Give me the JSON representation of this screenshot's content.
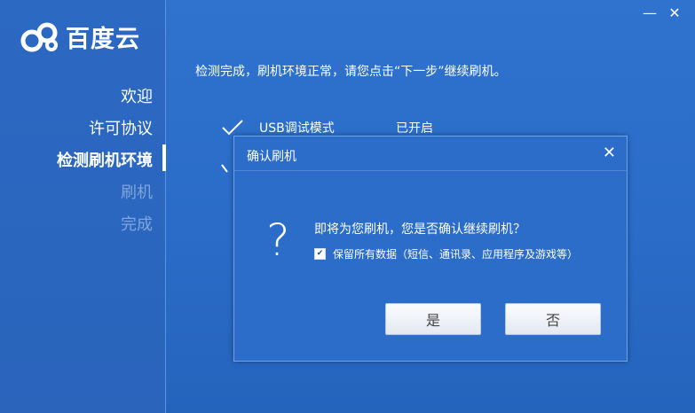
{
  "app": {
    "name": "百度云"
  },
  "window_controls": {
    "minimize": "—",
    "close": "✕"
  },
  "sidebar": {
    "steps": [
      {
        "label": "欢迎",
        "state": "done"
      },
      {
        "label": "许可协议",
        "state": "done"
      },
      {
        "label": "检测刷机环境",
        "state": "active"
      },
      {
        "label": "刷机",
        "state": "pending"
      },
      {
        "label": "完成",
        "state": "pending"
      }
    ]
  },
  "main": {
    "intro_text": "检测完成，刷机环境正常，请您点击“下一步”继续刷机。",
    "checks": [
      {
        "name": "USB调试模式",
        "status": "已开启"
      }
    ]
  },
  "dialog": {
    "title": "确认刷机",
    "close": "✕",
    "question_icon": "?",
    "question": "即将为您刷机，您是否确认继续刷机？",
    "keep_data_label": "保留所有数据（短信、通讯录、应用程序及游戏等）",
    "keep_data_checked": true,
    "yes_label": "是",
    "no_label": "否"
  },
  "colors": {
    "background": "#2a6cc8",
    "dialog_bg": "#2b6dc9",
    "button_bg": "#f2f5fa"
  }
}
